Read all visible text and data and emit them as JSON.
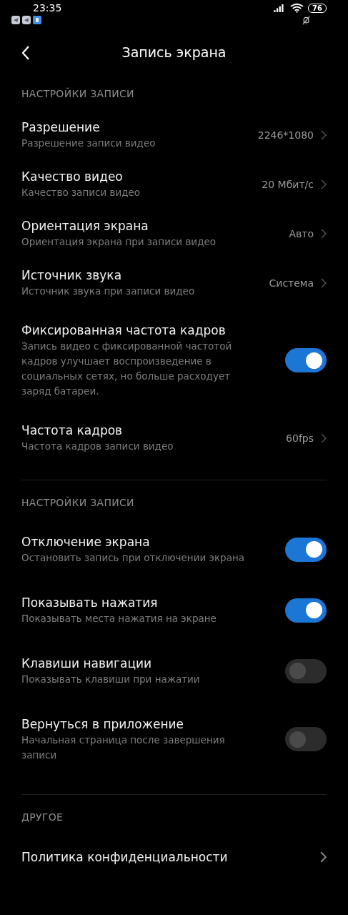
{
  "status_bar": {
    "time": "23:35",
    "battery": "76"
  },
  "header": {
    "title": "Запись экрана"
  },
  "sections": [
    {
      "title": "НАСТРОЙКИ ЗАПИСИ",
      "items": [
        {
          "kind": "value",
          "title": "Разрешение",
          "subtitle": "Разрешение записи видео",
          "value": "2246*1080"
        },
        {
          "kind": "value",
          "title": "Качество видео",
          "subtitle": "Качество записи видео",
          "value": "20 Мбит/с"
        },
        {
          "kind": "value",
          "title": "Ориентация экрана",
          "subtitle": "Ориентация экрана при записи видео",
          "value": "Авто"
        },
        {
          "kind": "value",
          "title": "Источник звука",
          "subtitle": "Источник звука при записи видео",
          "value": "Система"
        },
        {
          "kind": "toggle",
          "title": "Фиксированная частота кадров",
          "subtitle": "Запись видео с фиксированной частотой кадров улучшает воспроизведение в социальных сетях, но больше расходует заряд батареи.",
          "on": true
        },
        {
          "kind": "value",
          "title": "Частота кадров",
          "subtitle": "Частота кадров записи видео",
          "value": "60fps"
        }
      ]
    },
    {
      "title": "НАСТРОЙКИ ЗАПИСИ",
      "items": [
        {
          "kind": "toggle",
          "title": "Отключение экрана",
          "subtitle": "Остановить запись при отключении экрана",
          "on": true
        },
        {
          "kind": "toggle",
          "title": "Показывать нажатия",
          "subtitle": "Показывать места нажатия на экране",
          "on": true
        },
        {
          "kind": "toggle",
          "title": "Клавиши навигации",
          "subtitle": "Показывать клавиши при нажатии",
          "on": false
        },
        {
          "kind": "toggle",
          "title": "Вернуться в приложение",
          "subtitle": "Начальная страница после завершения записи",
          "on": false
        }
      ]
    },
    {
      "title": "ДРУГОЕ",
      "items": [
        {
          "kind": "link",
          "title": "Политика конфиденциальности"
        }
      ]
    }
  ]
}
